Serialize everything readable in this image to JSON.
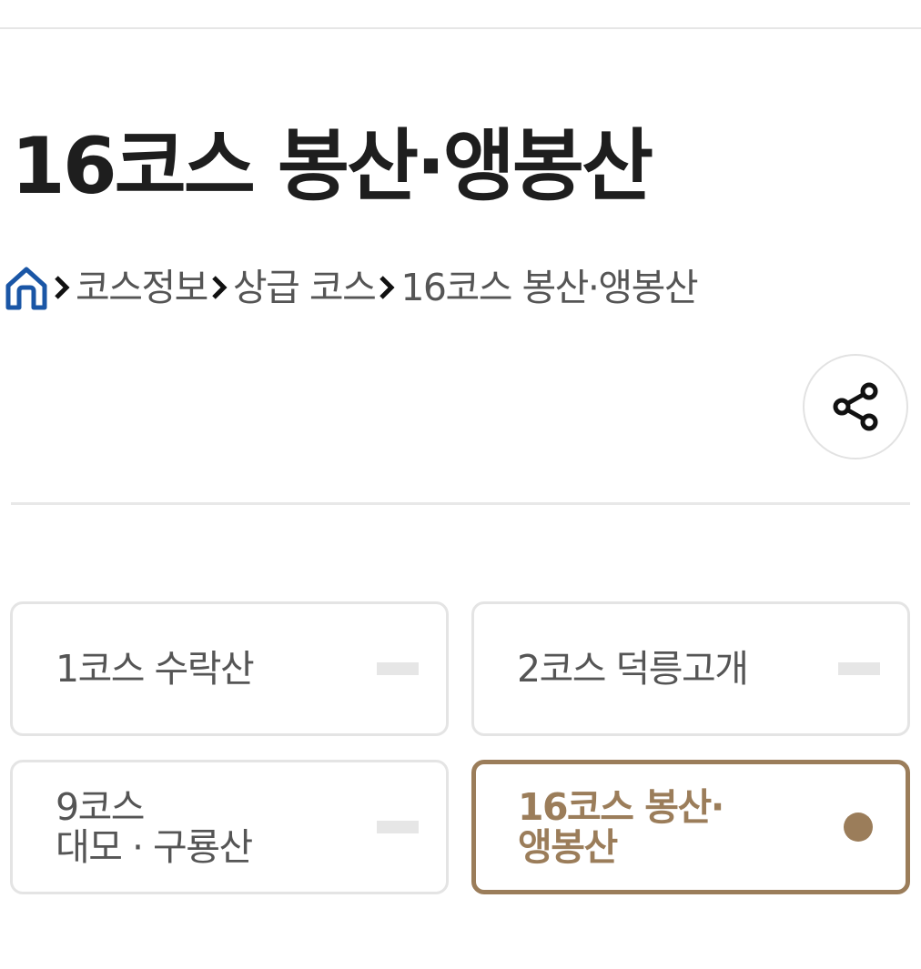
{
  "page": {
    "title": "16코스 봉산·앵봉산"
  },
  "breadcrumb": {
    "home_icon": "home-icon",
    "separator_icon": "chevron-right-icon",
    "items": [
      "코스정보",
      "상급 코스",
      "16코스 봉산·앵봉산"
    ]
  },
  "share": {
    "icon": "share-icon"
  },
  "courses": [
    {
      "label": "1코스 수락산",
      "active": false
    },
    {
      "label": "2코스 덕릉고개",
      "active": false
    },
    {
      "label": "9코스\n대모 · 구룡산",
      "active": false
    },
    {
      "label": "16코스 봉산·\n앵봉산",
      "active": true
    }
  ],
  "colors": {
    "accent": "#9b7d5a",
    "home_icon": "#1a56a6",
    "title": "#1e1e1e",
    "muted_text": "#555555",
    "card_border": "#e4e4e4"
  }
}
